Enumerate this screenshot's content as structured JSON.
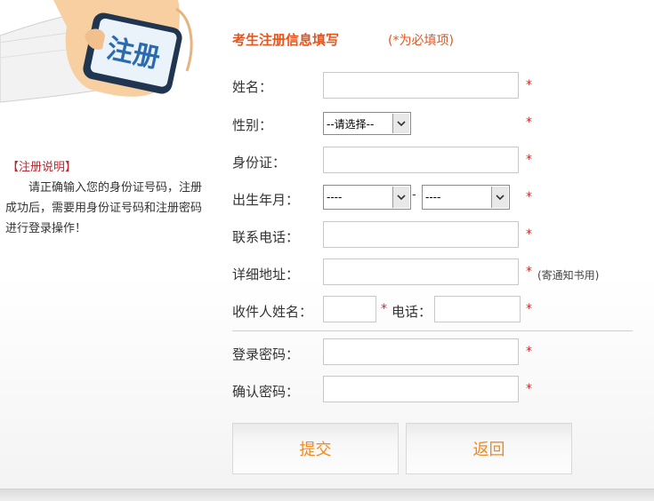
{
  "banner": {
    "icon_text": "注册"
  },
  "notes": {
    "title": "【注册说明】",
    "body": "请正确输入您的身份证号码，注册成功后，需要用身份证号码和注册密码进行登录操作！"
  },
  "header": {
    "title": "考生注册信息填写",
    "required_note": "(*为必填项)"
  },
  "form": {
    "name_label": "姓名：",
    "gender_label": "性别：",
    "gender_value": "--请选择--",
    "id_label": "身份证：",
    "birth_label": "出生年月：",
    "birth_year_value": "----",
    "birth_dash": "-",
    "birth_month_value": "----",
    "phone_label": "联系电话：",
    "address_label": "详细地址：",
    "address_hint": "(寄通知书用)",
    "recipient_label": "收件人姓名：",
    "recipient_phone_label": "电话：",
    "password_label": "登录密码：",
    "confirm_label": "确认密码：",
    "required_mark": "*"
  },
  "buttons": {
    "submit": "提交",
    "back": "返回"
  },
  "colors": {
    "accent": "#e8541b",
    "required": "#e02020",
    "button_text": "#f0891e",
    "phone_blue": "#2a6bb0"
  }
}
